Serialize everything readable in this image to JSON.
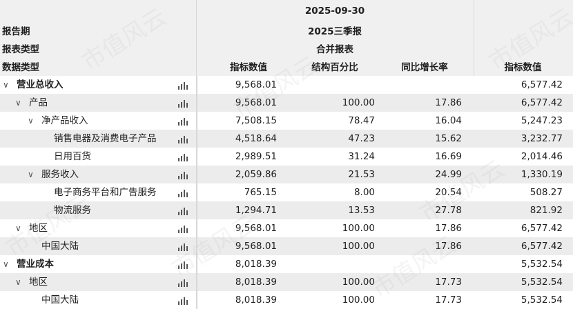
{
  "header": {
    "row_labels": [
      "报告期",
      "报表类型",
      "数据类型"
    ],
    "period_date": "2025-09-30",
    "period_name": "2025三季报",
    "report_type": "合并报表",
    "columns": [
      "指标数值",
      "结构百分比",
      "同比增长率",
      "指标数值"
    ]
  },
  "rows": [
    {
      "label": "营业总收入",
      "bold": true,
      "level": 0,
      "expand": true,
      "v1": "9,568.01",
      "v2": "",
      "v3": "",
      "v4": "6,577.42"
    },
    {
      "label": "产品",
      "bold": false,
      "level": 1,
      "expand": true,
      "v1": "9,568.01",
      "v2": "100.00",
      "v3": "17.86",
      "v4": "6,577.42"
    },
    {
      "label": "净产品收入",
      "bold": false,
      "level": 2,
      "expand": true,
      "v1": "7,508.15",
      "v2": "78.47",
      "v3": "16.04",
      "v4": "5,247.23"
    },
    {
      "label": "销售电器及消费电子产品",
      "bold": false,
      "level": 3,
      "expand": false,
      "v1": "4,518.64",
      "v2": "47.23",
      "v3": "15.62",
      "v4": "3,232.77"
    },
    {
      "label": "日用百货",
      "bold": false,
      "level": 3,
      "expand": false,
      "v1": "2,989.51",
      "v2": "31.24",
      "v3": "16.69",
      "v4": "2,014.46"
    },
    {
      "label": "服务收入",
      "bold": false,
      "level": 2,
      "expand": true,
      "v1": "2,059.86",
      "v2": "21.53",
      "v3": "24.99",
      "v4": "1,330.19"
    },
    {
      "label": "电子商务平台和广告服务",
      "bold": false,
      "level": 3,
      "expand": false,
      "v1": "765.15",
      "v2": "8.00",
      "v3": "20.54",
      "v4": "508.27"
    },
    {
      "label": "物流服务",
      "bold": false,
      "level": 3,
      "expand": false,
      "v1": "1,294.71",
      "v2": "13.53",
      "v3": "27.78",
      "v4": "821.92"
    },
    {
      "label": "地区",
      "bold": false,
      "level": 1,
      "expand": true,
      "v1": "9,568.01",
      "v2": "100.00",
      "v3": "17.86",
      "v4": "6,577.42"
    },
    {
      "label": "中国大陆",
      "bold": false,
      "level": 2,
      "expand": false,
      "v1": "9,568.01",
      "v2": "100.00",
      "v3": "17.86",
      "v4": "6,577.42"
    },
    {
      "label": "营业成本",
      "bold": true,
      "level": 0,
      "expand": true,
      "v1": "8,018.39",
      "v2": "",
      "v3": "",
      "v4": "5,532.54"
    },
    {
      "label": "地区",
      "bold": false,
      "level": 1,
      "expand": true,
      "v1": "8,018.39",
      "v2": "100.00",
      "v3": "17.73",
      "v4": "5,532.54"
    },
    {
      "label": "中国大陆",
      "bold": false,
      "level": 2,
      "expand": false,
      "v1": "8,018.39",
      "v2": "100.00",
      "v3": "17.73",
      "v4": "5,532.54"
    }
  ],
  "icons": {
    "expand": "chevron-down-icon",
    "chart": "bar-chart-icon"
  },
  "watermark": "市值风云",
  "colors": {
    "header_bg": "#f0f0f0",
    "shade_row": "#ececec",
    "divider": "#d9d9d9"
  }
}
